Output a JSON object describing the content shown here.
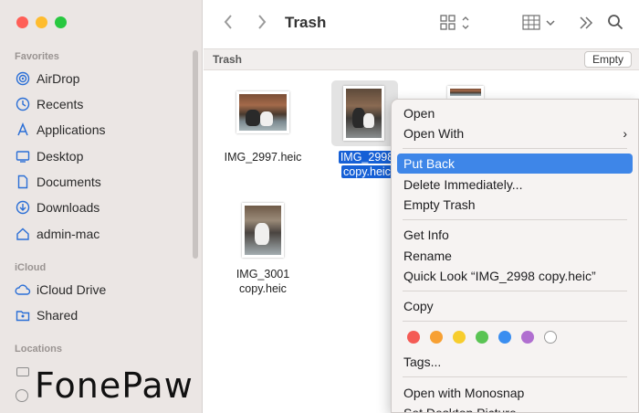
{
  "colors": {
    "traffic_red": "#ff5f57",
    "traffic_yellow": "#febc2e",
    "traffic_green": "#28c840",
    "accent": "#3e86e8",
    "selection": "#1660d6"
  },
  "toolbar": {
    "title": "Trash",
    "back_icon": "chevron-left-icon",
    "forward_icon": "chevron-right-icon",
    "view_icon": "grid-view-icon",
    "group_icon": "group-by-icon",
    "more_icon": "double-chevron-right-icon",
    "search_icon": "search-icon"
  },
  "pathbar": {
    "label": "Trash",
    "empty_button": "Empty"
  },
  "sidebar": {
    "favorites_header": "Favorites",
    "favorites": [
      {
        "label": "AirDrop",
        "icon": "airdrop-icon"
      },
      {
        "label": "Recents",
        "icon": "clock-icon"
      },
      {
        "label": "Applications",
        "icon": "applications-icon"
      },
      {
        "label": "Desktop",
        "icon": "desktop-icon"
      },
      {
        "label": "Documents",
        "icon": "document-icon"
      },
      {
        "label": "Downloads",
        "icon": "download-icon"
      },
      {
        "label": "admin-mac",
        "icon": "home-icon"
      }
    ],
    "icloud_header": "iCloud",
    "icloud": [
      {
        "label": "iCloud Drive",
        "icon": "cloud-icon"
      },
      {
        "label": "Shared",
        "icon": "shared-folder-icon"
      }
    ],
    "locations_header": "Locations"
  },
  "files": [
    {
      "name_line1": "IMG_2997.heic",
      "name_line2": ""
    },
    {
      "name_line1": "IMG_2998",
      "name_line2": "copy.heic"
    },
    {
      "name_line1": "IMG_3001",
      "name_line2": "copy.heic"
    }
  ],
  "context_menu": {
    "open": "Open",
    "open_with": "Open With",
    "put_back": "Put Back",
    "delete_immediately": "Delete Immediately...",
    "empty_trash": "Empty Trash",
    "get_info": "Get Info",
    "rename": "Rename",
    "quick_look": "Quick Look “IMG_2998 copy.heic”",
    "copy": "Copy",
    "tags": "Tags...",
    "open_with_monosnap": "Open with Monosnap",
    "set_desktop_picture": "Set Desktop Picture",
    "tag_colors": [
      "#f45b55",
      "#f7a033",
      "#f7cd2d",
      "#5ac454",
      "#3a8ef0",
      "#b06fd0",
      "#ffffff"
    ]
  },
  "watermark": {
    "text_a": "FonePa",
    "text_b": "w"
  }
}
